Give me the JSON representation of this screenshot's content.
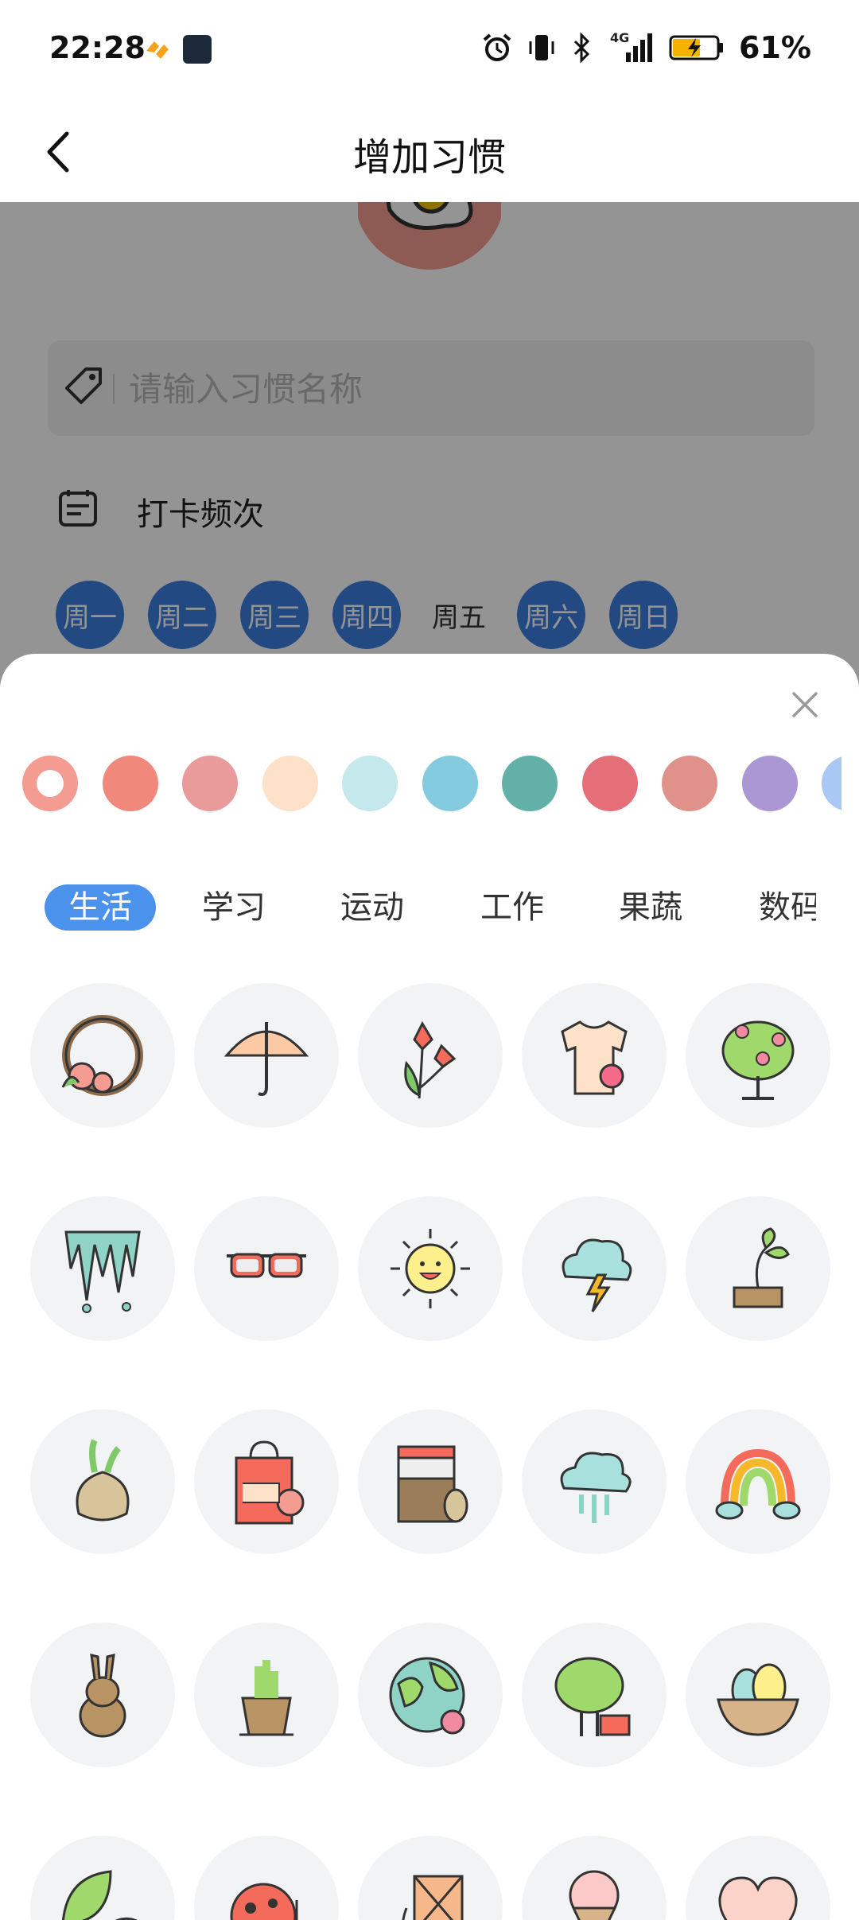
{
  "status_bar": {
    "time": "22:28",
    "network": "4G",
    "battery": "61%"
  },
  "header": {
    "title": "增加习惯",
    "back_icon": "chevron-left-icon"
  },
  "form": {
    "avatar_icon": "fried-egg-icon",
    "name_placeholder": "请输入习惯名称",
    "frequency_label": "打卡频次",
    "weekdays": [
      {
        "label": "周一",
        "selected": true
      },
      {
        "label": "周二",
        "selected": true
      },
      {
        "label": "周三",
        "selected": true
      },
      {
        "label": "周四",
        "selected": true
      },
      {
        "label": "周五",
        "selected": false
      },
      {
        "label": "周六",
        "selected": true
      },
      {
        "label": "周日",
        "selected": true
      }
    ]
  },
  "picker": {
    "colors": [
      "#f49b92",
      "#f0887b",
      "#e89b9a",
      "#fde1c8",
      "#c5e8ec",
      "#84cbdf",
      "#63b0a8",
      "#e56f78",
      "#e0928a",
      "#ab97d4",
      "#a9c8f3"
    ],
    "selected_color_index": 0,
    "tabs": [
      "生活",
      "学习",
      "运动",
      "工作",
      "果蔬",
      "数码"
    ],
    "active_tab": 0,
    "icons": [
      "wreath-icon",
      "umbrella-icon",
      "tulip-icon",
      "tshirt-icon",
      "flower-tree-icon",
      "icicles-icon",
      "sunglasses-icon",
      "sun-icon",
      "thunder-cloud-icon",
      "sprout-icon",
      "onion-icon",
      "shopping-bag-icon",
      "jar-icon",
      "rain-cloud-icon",
      "rainbow-icon",
      "rabbit-icon",
      "plant-pot-icon",
      "earth-icon",
      "picnic-tree-icon",
      "nest-eggs-icon",
      "leaves-icon",
      "ladybug-icon",
      "kite-icon",
      "ice-cream-icon",
      "heart-icon"
    ]
  }
}
